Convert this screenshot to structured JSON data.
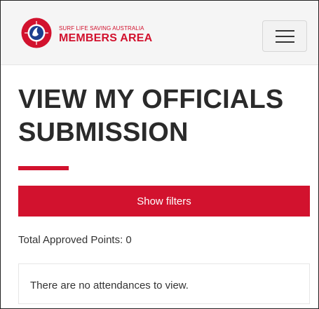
{
  "header": {
    "org_name": "SURF LIFE SAVING AUSTRALIA",
    "area_name": "MEMBERS AREA",
    "logo_icon": "surf-life-saving-logo-icon",
    "logo_text": "SURF LIFE SAVING",
    "menu_icon": "hamburger-menu-icon"
  },
  "page": {
    "title_line_1": "VIEW MY OFFICIALS",
    "title_line_2": "SUBMISSION"
  },
  "filters": {
    "button_label": "Show filters"
  },
  "summary": {
    "total_points_text": "Total Approved Points: 0"
  },
  "results": {
    "empty_message": "There are no attendances to view."
  },
  "colors": {
    "brand_red": "#d2122e",
    "logo_blue": "#1d3f8f",
    "heading_text": "#2a2a2a",
    "header_bg": "#f5f5f5"
  }
}
